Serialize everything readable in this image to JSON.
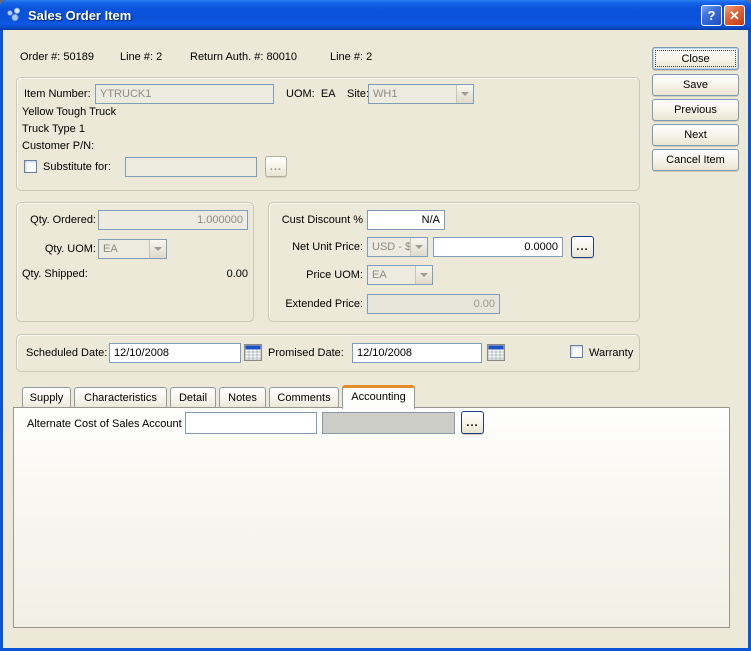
{
  "window": {
    "title": "Sales Order Item",
    "help_glyph": "?",
    "close_glyph": "✕"
  },
  "header": {
    "order_label": "Order #:",
    "order_value": "50189",
    "line1_label": "Line #:",
    "line1_value": "2",
    "return_auth_label": "Return Auth. #:",
    "return_auth_value": "80010",
    "line2_label": "Line #:",
    "line2_value": "2"
  },
  "actions": {
    "close": "Close",
    "save": "Save",
    "previous": "Previous",
    "next": "Next",
    "cancel_item": "Cancel Item"
  },
  "item": {
    "item_number_label": "Item Number:",
    "item_number_value": "YTRUCK1",
    "uom_label": "UOM:",
    "uom_value": "EA",
    "site_label": "Site:",
    "site_value": "WH1",
    "description1": "Yellow Tough Truck",
    "description2": "Truck Type 1",
    "customer_pn_label": "Customer P/N:",
    "substitute_label": "Substitute for:",
    "substitute_value": "",
    "browse_label": "..."
  },
  "quantity": {
    "ordered_label": "Qty. Ordered:",
    "ordered_value": "1.000000",
    "uom_label": "Qty. UOM:",
    "uom_value": "EA",
    "shipped_label": "Qty. Shipped:",
    "shipped_value": "0.00"
  },
  "pricing": {
    "discount_label": "Cust Discount %",
    "discount_value": "N/A",
    "net_unit_price_label": "Net Unit Price:",
    "currency_value": "USD - $",
    "net_unit_price_value": "0.0000",
    "price_uom_label": "Price UOM:",
    "price_uom_value": "EA",
    "extended_price_label": "Extended Price:",
    "extended_price_value": "0.00",
    "browse_label": "..."
  },
  "dates": {
    "scheduled_label": "Scheduled Date:",
    "scheduled_value": "12/10/2008",
    "promised_label": "Promised Date:",
    "promised_value": "12/10/2008",
    "warranty_label": "Warranty"
  },
  "tabs": {
    "active": "Accounting",
    "items": [
      {
        "label": "Supply"
      },
      {
        "label": "Characteristics"
      },
      {
        "label": "Detail"
      },
      {
        "label": "Notes"
      },
      {
        "label": "Comments"
      },
      {
        "label": "Accounting"
      }
    ]
  },
  "accounting": {
    "alt_cos_label": "Alternate Cost of Sales Account",
    "account_value": "",
    "account_desc": "",
    "browse_label": "..."
  },
  "colors": {
    "titlebar_blue": "#0A53DC",
    "dialog_bg": "#ECE9D8",
    "active_tab_orange": "#E68B2C",
    "close_button_red": "#D14A1E",
    "input_border_blue": "#7F9DB9"
  }
}
